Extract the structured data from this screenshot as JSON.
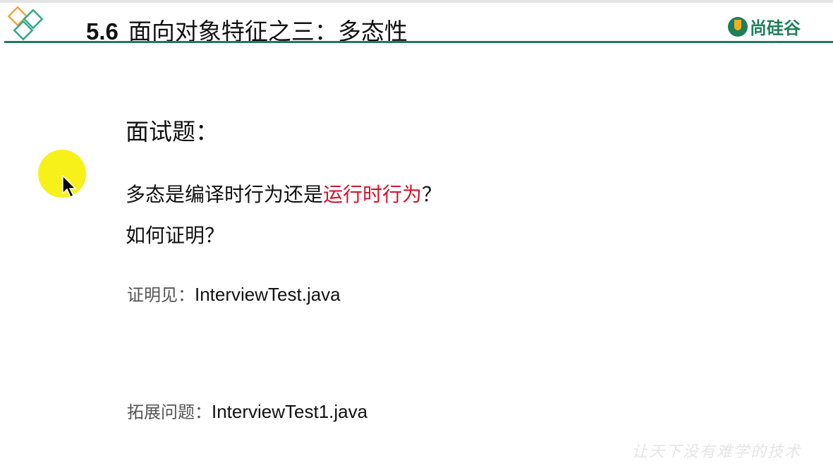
{
  "header": {
    "section_number": "5.6",
    "title": "面向对象特征之三：多态性",
    "brand": "尚硅谷"
  },
  "content": {
    "heading": "面试题：",
    "question1_prefix": "多态是编译时行为还是",
    "question1_highlight": "运行时行为",
    "question1_suffix": "？",
    "question2": "如何证明？",
    "proof_label": "证明见：",
    "proof_file": "InterviewTest.java",
    "extension_label": "拓展问题：",
    "extension_file": "InterviewTest1.java"
  },
  "watermark": "让天下没有难学的技术",
  "colors": {
    "accent_green": "#1f7a60",
    "highlight_red": "#d0142c",
    "cursor_highlight": "#f6f000"
  }
}
